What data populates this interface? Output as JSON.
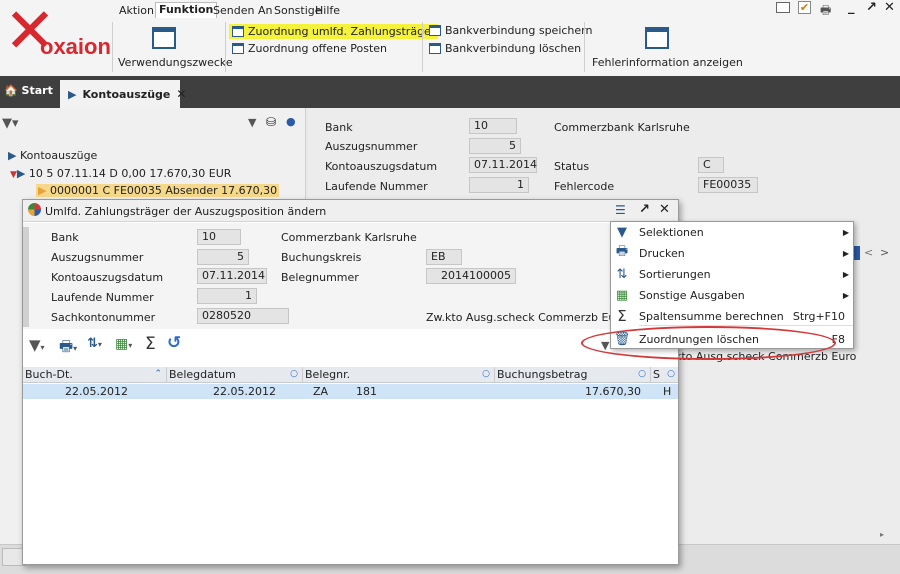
{
  "app": {
    "logo_text": "oxaion"
  },
  "menu": {
    "items": [
      "Aktion",
      "Funktion",
      "Senden An",
      "Sonstige",
      "Hilfe"
    ],
    "active": "Funktion"
  },
  "ribbon": {
    "verwendungszwecke": "Verwendungszwecke",
    "zuordnung_umfld": "Zuordnung umlfd. Zahlungsträger",
    "zuordnung_offene": "Zuordnung offene Posten",
    "bank_speichern": "Bankverbindung speichern",
    "bank_loeschen": "Bankverbindung löschen",
    "fehlerinfo": "Fehlerinformation anzeigen"
  },
  "tabs": {
    "start": "Start",
    "kontoauszuege": "Kontoauszüge"
  },
  "tree": {
    "root": "Kontoauszüge",
    "node1": "10  5  07.11.14  D   0,00  17.670,30  EUR",
    "node2": "0000001  C  FE00035  Absender  17.670,30"
  },
  "detail": {
    "bank_label": "Bank",
    "bank_value": "10",
    "bank_name": "Commerzbank Karlsruhe",
    "auszugsnummer_label": "Auszugsnummer",
    "auszugsnummer_value": "5",
    "kontoauszugsdatum_label": "Kontoauszugsdatum",
    "kontoauszugsdatum_value": "07.11.2014",
    "status_label": "Status",
    "status_value": "C",
    "laufende_label": "Laufende Nummer",
    "laufende_value": "1",
    "fehlercode_label": "Fehlercode",
    "fehlercode_value": "FE00035",
    "partial_text": "kto Ausg.scheck Commerzb Euro"
  },
  "dialog": {
    "title": "Umlfd. Zahlungsträger der Auszugsposition ändern",
    "bank_label": "Bank",
    "bank_value": "10",
    "bank_name": "Commerzbank Karlsruhe",
    "auszugsnummer_label": "Auszugsnummer",
    "auszugsnummer_value": "5",
    "buchungskreis_label": "Buchungskreis",
    "buchungskreis_value": "EB",
    "kontoauszugsdatum_label": "Kontoauszugsdatum",
    "kontoauszugsdatum_value": "07.11.2014",
    "belegnummer_label": "Belegnummer",
    "belegnummer_value": "2014100005",
    "laufende_label": "Laufende Nummer",
    "laufende_value": "1",
    "sachkonto_label": "Sachkontonummer",
    "sachkonto_value": "0280520",
    "sachkonto_desc": "Zw.kto Ausg.scheck Commerzb Euro",
    "columns": [
      "Buch-Dt.",
      "Belegdatum",
      "Belegnr.",
      "Buchungsbetrag",
      "S"
    ],
    "rows": [
      {
        "buchdt": "22.05.2012",
        "belegdatum": "22.05.2012",
        "belegnr": "ZA        181",
        "betrag": "17.670,30",
        "s": "H"
      }
    ]
  },
  "context_menu": {
    "items": [
      {
        "label": "Selektionen",
        "icon": "filter-icon",
        "submenu": true
      },
      {
        "label": "Drucken",
        "icon": "printer-icon",
        "submenu": true
      },
      {
        "label": "Sortierungen",
        "icon": "sort-icon",
        "submenu": true
      },
      {
        "label": "Sonstige Ausgaben",
        "icon": "export-icon",
        "submenu": true
      },
      {
        "label": "Spaltensumme berechnen",
        "icon": "sum-icon",
        "shortcut": "Strg+F10"
      },
      {
        "label": "Zuordnungen löschen",
        "icon": "trash-icon",
        "shortcut": "F8"
      }
    ],
    "highlight_color": "#d23a3a"
  }
}
